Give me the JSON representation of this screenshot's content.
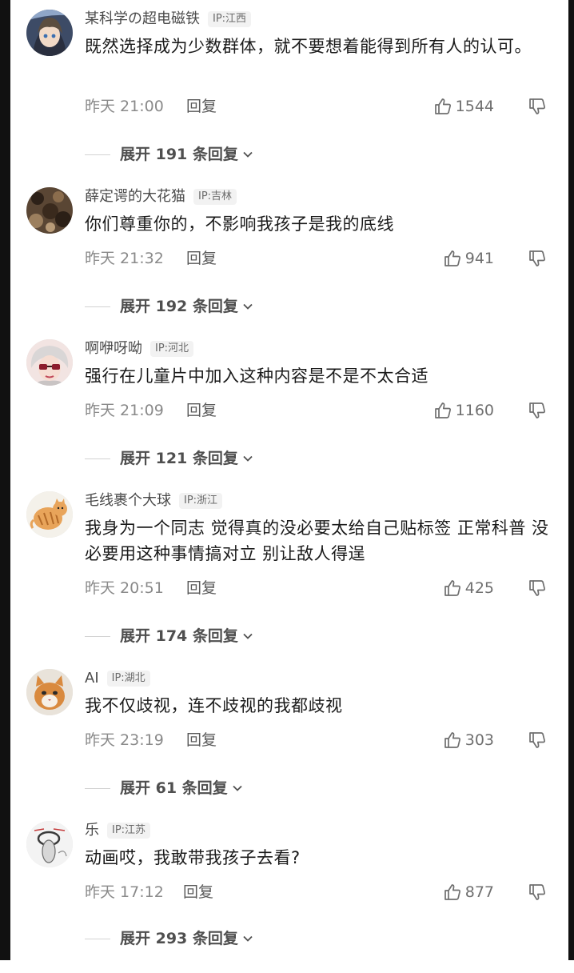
{
  "comments": [
    {
      "username": "某科学の超电磁铁",
      "ip": "IP:江西",
      "text": "既然选择成为少数群体，就不要想着能得到所有人的认可。",
      "time": "昨天 21:00",
      "reply_label": "回复",
      "likes": "1544",
      "expand_label": "展开 191 条回复"
    },
    {
      "username": "薛定谔的大花猫",
      "ip": "IP:吉林",
      "text": "你们尊重你的，不影响我孩子是我的底线",
      "time": "昨天 21:32",
      "reply_label": "回复",
      "likes": "941",
      "expand_label": "展开 192 条回复"
    },
    {
      "username": "啊咿呀呦",
      "ip": "IP:河北",
      "text": "强行在儿童片中加入这种内容是不是不太合适",
      "time": "昨天 21:09",
      "reply_label": "回复",
      "likes": "1160",
      "expand_label": "展开 121 条回复"
    },
    {
      "username": "毛线裹个大球",
      "ip": "IP:浙江",
      "text": "我身为一个同志 觉得真的没必要太给自己贴标签 正常科普 没必要用这种事情搞对立 别让敌人得逞",
      "time": "昨天 20:51",
      "reply_label": "回复",
      "likes": "425",
      "expand_label": "展开 174 条回复"
    },
    {
      "username": "AI",
      "ip": "IP:湖北",
      "text": "我不仅歧视，连不歧视的我都歧视",
      "time": "昨天 23:19",
      "reply_label": "回复",
      "likes": "303",
      "expand_label": "展开 61 条回复"
    },
    {
      "username": "乐",
      "ip": "IP:江苏",
      "text": "动画哎，我敢带我孩子去看?",
      "time": "昨天 17:12",
      "reply_label": "回复",
      "likes": "877",
      "expand_label": "展开 293 条回复"
    }
  ],
  "icons": {
    "like": "thumbs-up-icon",
    "dislike": "thumbs-down-icon",
    "expand": "chevron-down-icon"
  },
  "colors": {
    "text_primary": "#1a1a1a",
    "text_secondary": "#8a8a8a",
    "badge_bg": "#f2f2f2"
  }
}
